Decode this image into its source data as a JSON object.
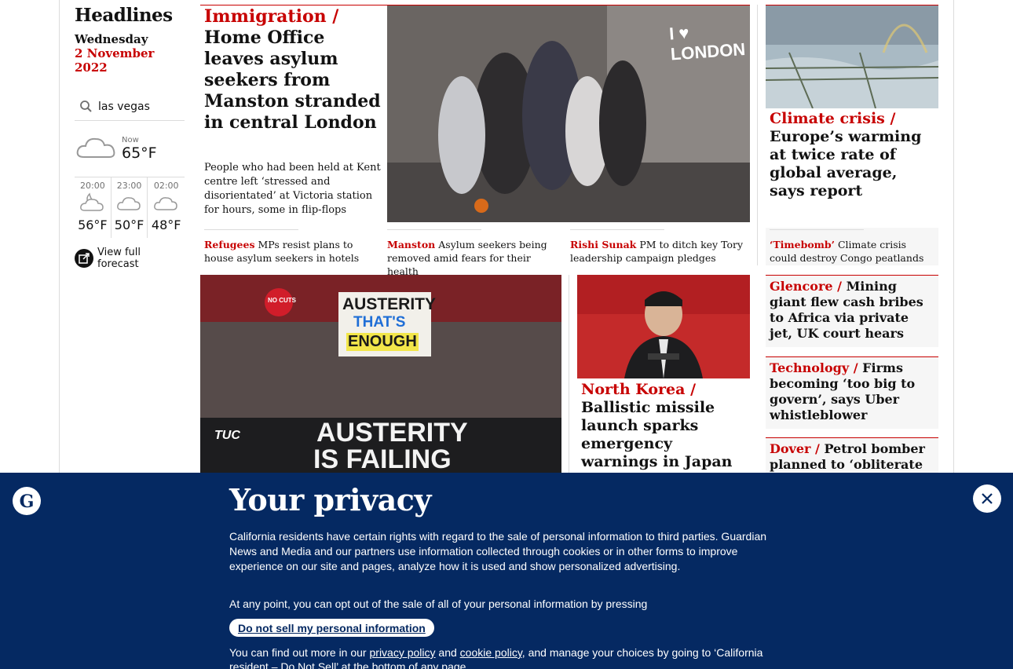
{
  "header": {
    "title": "Headlines",
    "day": "Wednesday",
    "date": "2 November 2022"
  },
  "weather": {
    "location": "las vegas",
    "now_label": "Now",
    "now_temp": "65°F",
    "forecast": [
      {
        "time": "20:00",
        "temp": "56°F",
        "icon": "partly-cloudy-night-icon"
      },
      {
        "time": "23:00",
        "temp": "50°F",
        "icon": "cloud-icon"
      },
      {
        "time": "02:00",
        "temp": "48°F",
        "icon": "cloud-icon"
      }
    ],
    "full_forecast": "View full forecast"
  },
  "lead": {
    "kicker": "Immigration",
    "headline": "Home Office leaves asylum seekers from Manston stranded in central London",
    "standfirst": "People who had been held at Kent centre left ‘stressed and disorientated’ at Victoria station for hours, some in flip-flops",
    "sublinks": [
      {
        "kicker": "Refugees",
        "text": "MPs resist plans to house asylum seekers in hotels"
      },
      {
        "kicker": "Manston",
        "text": "Asylum seekers being removed amid fears for their health"
      },
      {
        "kicker": "Rishi Sunak",
        "text": "PM to ditch key Tory leadership campaign pledges"
      }
    ],
    "image_sign": "I ♥ LONDON"
  },
  "climate": {
    "kicker": "Climate crisis",
    "headline": "Europe’s warming at twice rate of global average, says report",
    "sublink_kicker": "‘Timebomb’",
    "sublink_text": "Climate crisis could destroy Congo peatlands"
  },
  "austerity_image": {
    "sign_top_1": "AUSTERITY",
    "sign_top_2": "THAT'S",
    "sign_top_3": "ENOUGH",
    "banner_1": "AUSTERITY",
    "banner_2": "IS FAILING",
    "tuc": "TUC",
    "no_cuts": "NO CUTS"
  },
  "north_korea": {
    "kicker": "North Korea",
    "headline": "Ballistic missile launch sparks emergency warnings in Japan"
  },
  "right_stories": [
    {
      "kicker": "Glencore",
      "headline": "Mining giant flew cash bribes to Africa via private jet, UK court hears"
    },
    {
      "kicker": "Technology",
      "headline": "Firms becoming ‘too big to govern’, says Uber whistleblower"
    },
    {
      "kicker": "Dover",
      "headline": "Petrol bomber planned to ‘obliterate"
    }
  ],
  "privacy": {
    "title": "Your privacy",
    "p1": "California residents have certain rights with regard to the sale of personal information to third parties. Guardian News and Media and our partners use information collected through cookies or in other forms to improve experience on our site and pages, analyze how it is used and show personalized advertising.",
    "p2": "At any point, you can opt out of the sale of all of your personal information by pressing",
    "dns_button": "Do not sell my personal information",
    "p3_a": "You can find out more in our ",
    "privacy_link": "privacy policy",
    "p3_b": " and ",
    "cookie_link": "cookie policy",
    "p3_c": ", and manage your choices by going to ‘California resident – Do Not Sell’ at the bottom of any page."
  },
  "colors": {
    "accent": "#c70000",
    "privacy_bg": "#052962"
  }
}
